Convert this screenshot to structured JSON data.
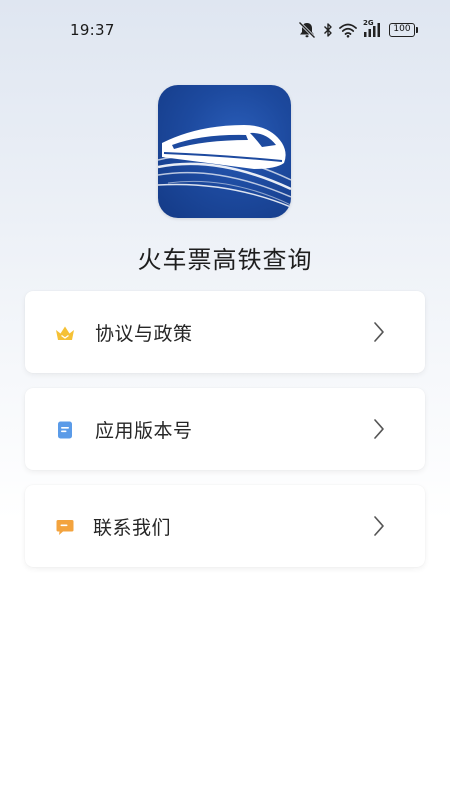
{
  "status_bar": {
    "time": "19:37",
    "network_label": "2G",
    "battery": "100",
    "icons": [
      "mute-bell-icon",
      "bluetooth-icon",
      "wifi-icon",
      "cellular-signal-icon",
      "battery-icon"
    ]
  },
  "app": {
    "logo_icon": "high-speed-train-icon",
    "title": "火车票高铁查询",
    "colors": {
      "logo_blue": "#1d4a9f"
    }
  },
  "menu": {
    "items": [
      {
        "label": "协议与政策",
        "icon": "crown-icon",
        "icon_color": "#f5c136"
      },
      {
        "label": "应用版本号",
        "icon": "document-icon",
        "icon_color": "#5b9be8"
      },
      {
        "label": "联系我们",
        "icon": "chat-bubble-icon",
        "icon_color": "#f3a33e"
      }
    ]
  }
}
